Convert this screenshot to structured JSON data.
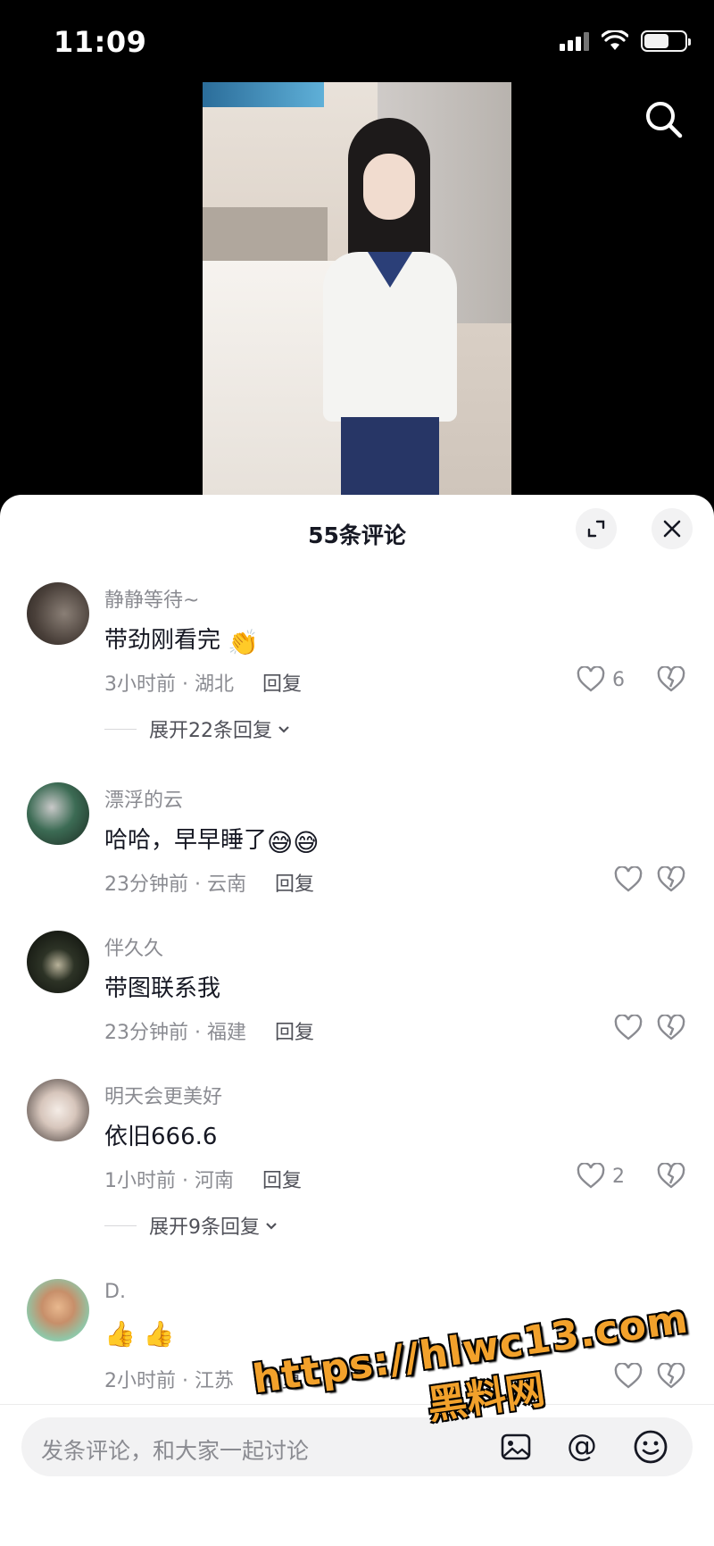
{
  "status_bar": {
    "time": "11:09"
  },
  "sheet": {
    "title": "55条评论"
  },
  "comments": [
    {
      "user": "静静等待~",
      "text": "带劲刚看完",
      "text_emoji": "👏",
      "time": "3小时前 · 湖北",
      "reply": "回复",
      "likes": "6",
      "expand": "展开22条回复"
    },
    {
      "user": "漂浮的云",
      "text": "哈哈，早早睡了",
      "text_emoji": "😅😅",
      "time": "23分钟前 · 云南",
      "reply": "回复",
      "likes": "",
      "expand": ""
    },
    {
      "user": "伴久久",
      "text": "带图联系我",
      "text_emoji": "",
      "time": "23分钟前 · 福建",
      "reply": "回复",
      "likes": "",
      "expand": ""
    },
    {
      "user": "明天会更美好",
      "text": "依旧666.6",
      "text_emoji": "",
      "time": "1小时前 · 河南",
      "reply": "回复",
      "likes": "2",
      "expand": "展开9条回复"
    },
    {
      "user": "D.",
      "text": "",
      "text_emoji": "👍 👍",
      "time": "2小时前 · 江苏",
      "reply": "回复",
      "likes": "",
      "expand": ""
    }
  ],
  "input": {
    "placeholder": "发条评论，和大家一起讨论"
  },
  "watermark": {
    "url": "https://hlwc13.com",
    "name": "黑料网"
  },
  "colors": {
    "text": "#161823",
    "meta": "#8a8b91",
    "accent": "#f2a12b"
  },
  "icons": [
    "search-icon",
    "expand-icon",
    "close-icon",
    "heart-icon",
    "broken-heart-icon",
    "image-icon",
    "at-icon",
    "emoji-icon"
  ]
}
